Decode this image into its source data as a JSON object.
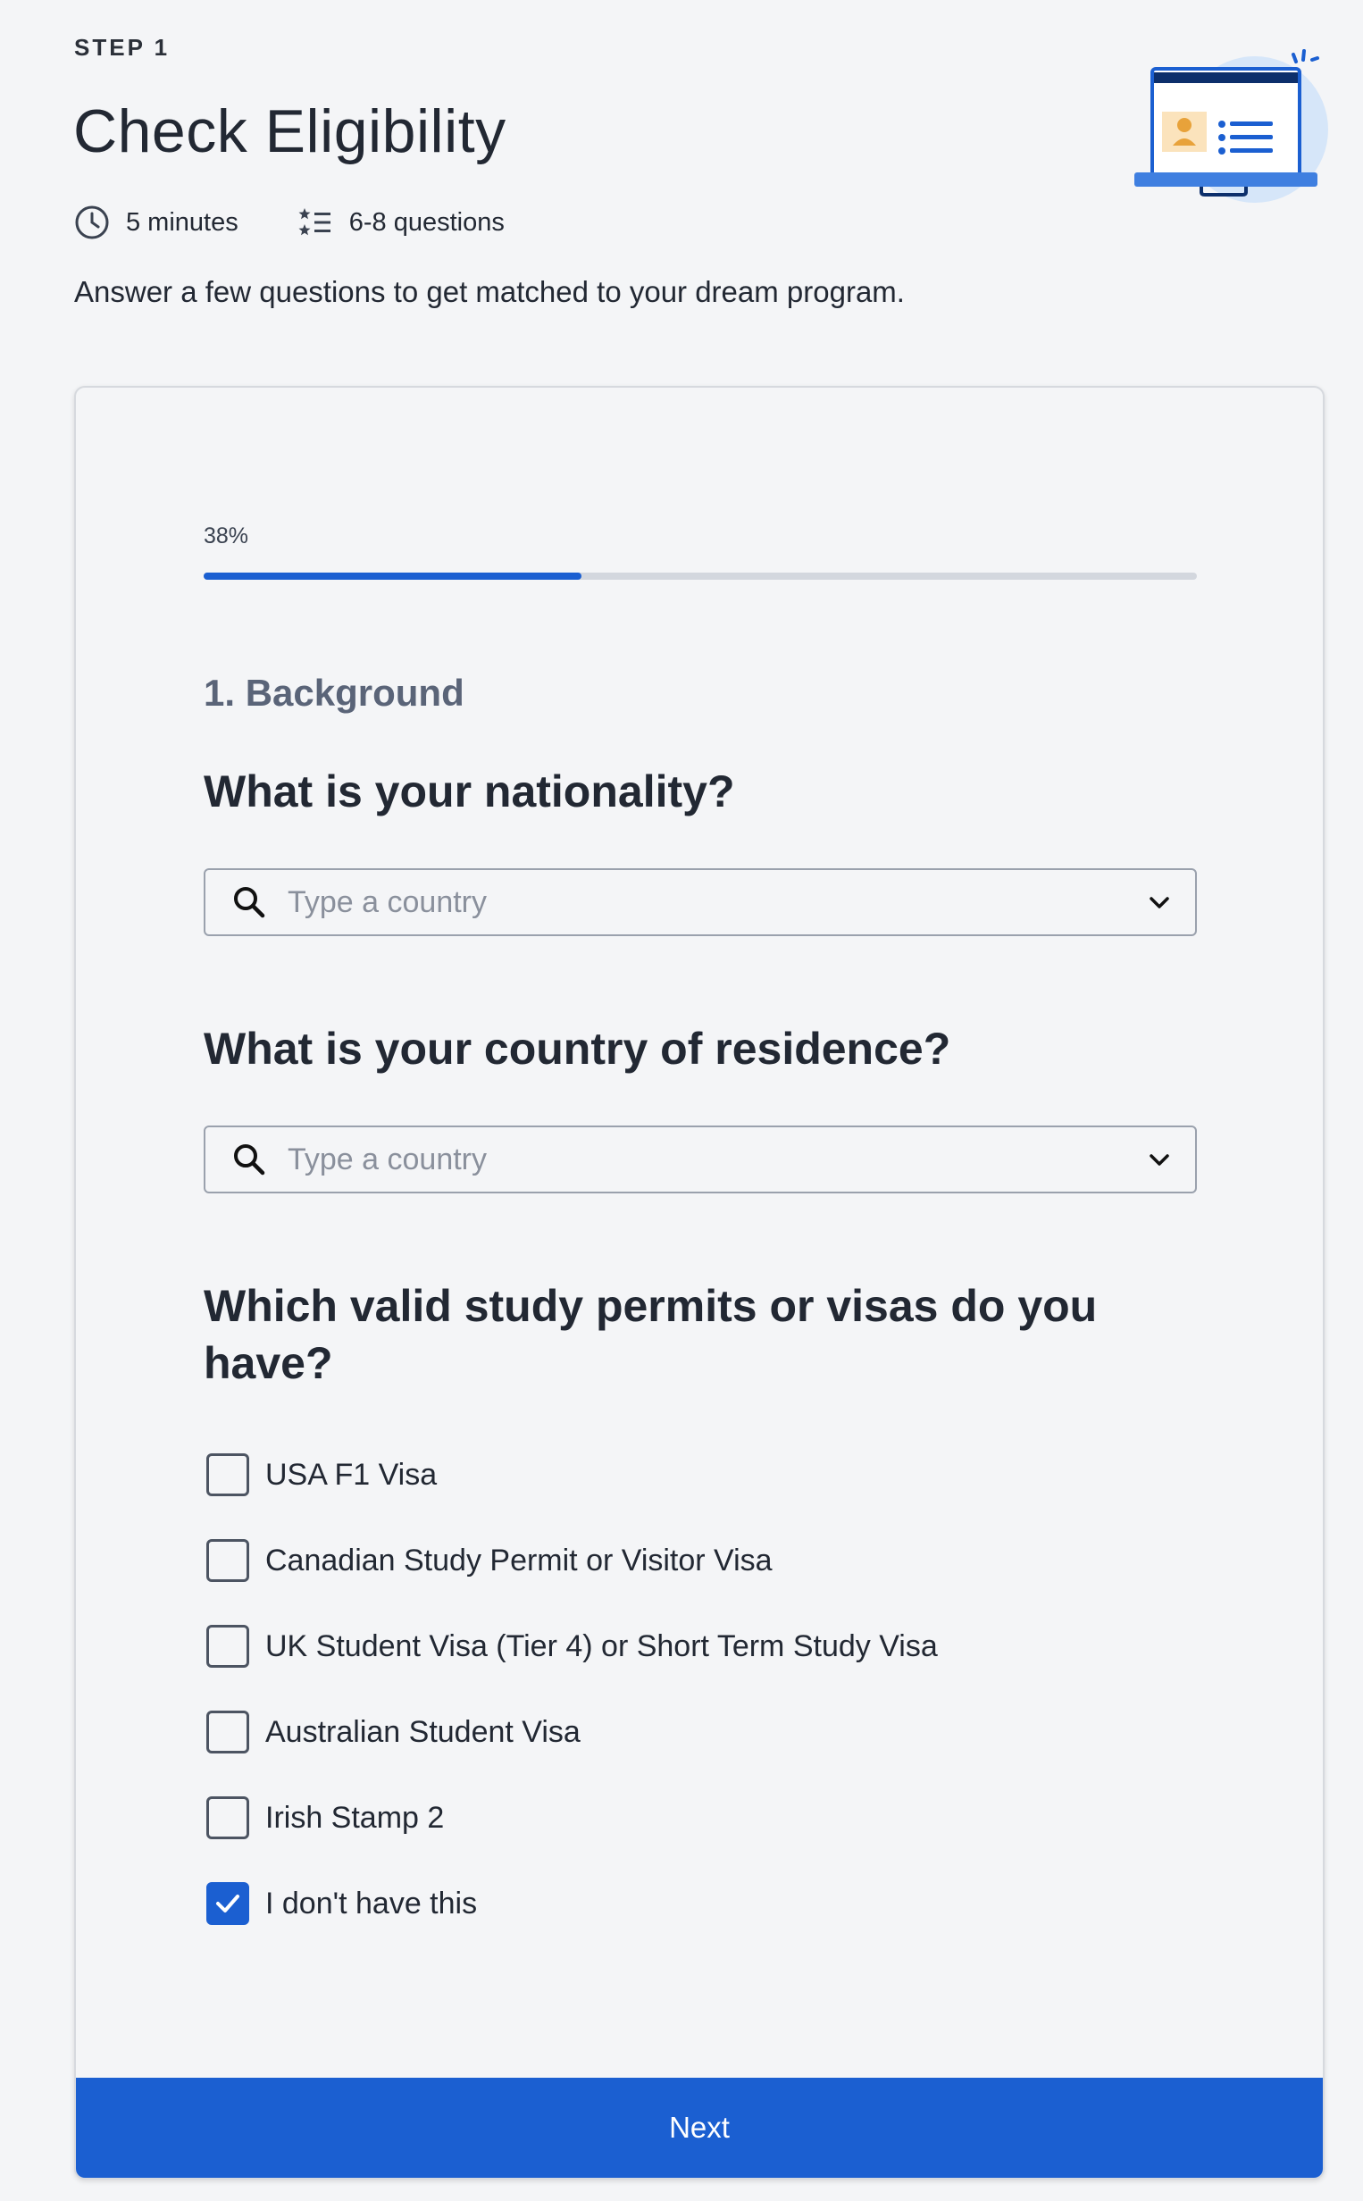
{
  "header": {
    "step_label": "STEP 1",
    "title": "Check Eligibility",
    "duration": "5 minutes",
    "question_count": "6-8 questions",
    "subtitle": "Answer a few questions to get matched to your dream program."
  },
  "illustration": {
    "icon": "laptop-profile-list-illustration"
  },
  "form": {
    "progress": {
      "label": "38%",
      "value": 0.38
    },
    "section_title": "1. Background",
    "q_nationality": {
      "question": "What is your nationality?",
      "placeholder": "Type a country"
    },
    "q_residence": {
      "question": "What is your country of residence?",
      "placeholder": "Type a country"
    },
    "q_permits": {
      "question": "Which valid study permits or visas do you have?",
      "options": [
        {
          "label": "USA F1 Visa",
          "checked": false
        },
        {
          "label": "Canadian Study Permit or Visitor Visa",
          "checked": false
        },
        {
          "label": "UK Student Visa (Tier 4) or Short Term Study Visa",
          "checked": false
        },
        {
          "label": "Australian Student Visa",
          "checked": false
        },
        {
          "label": "Irish Stamp 2",
          "checked": false
        },
        {
          "label": "I don't have this",
          "checked": true
        }
      ]
    },
    "next_label": "Next"
  },
  "colors": {
    "accent": "#1b5fd1",
    "track": "#d3d7de",
    "background": "#f4f5f7"
  }
}
